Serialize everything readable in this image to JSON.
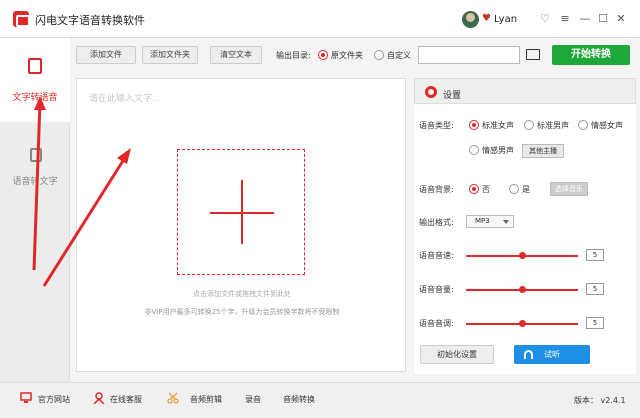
{
  "window": {
    "title": "闪电文字语音转换软件",
    "user": {
      "vip_icon": "heart-icon",
      "name": "Lyan"
    },
    "controls": [
      "skin-icon",
      "menu-icon",
      "minimize-icon",
      "maximize-icon",
      "close-icon"
    ],
    "control_glyphs": {
      "skin": "♡",
      "menu": "≡",
      "min": "—",
      "max": "☐",
      "close": "✕"
    }
  },
  "sidebar": {
    "items": [
      {
        "label": "文字转语音",
        "icon": "text-to-speech-icon",
        "active": true
      },
      {
        "label": "语音转文字",
        "icon": "speech-to-text-icon",
        "active": false
      }
    ]
  },
  "toolbar": {
    "add_file": "添加文件",
    "add_folder": "添加文件夹",
    "clear_text": "清空文本",
    "output_dir_label": "输出目录:",
    "output_options": [
      {
        "label": "原文件夹",
        "selected": true
      },
      {
        "label": "自定义",
        "selected": false
      }
    ],
    "output_path": "",
    "start_label": "开始转换"
  },
  "editor": {
    "placeholder": "请在此输入文字...",
    "drop_hint": "点击添加文件或拖拽文件到此处",
    "limit_note": "非VIP用户最多可转换25个字，升级为会员转换字数将不受限制"
  },
  "settings": {
    "title": "设置",
    "voice_type": {
      "label": "语音类型:",
      "options": [
        {
          "label": "标准女声",
          "selected": true
        },
        {
          "label": "标准男声",
          "selected": false
        },
        {
          "label": "情感女声",
          "selected": false
        },
        {
          "label": "情感男声",
          "selected": false
        }
      ],
      "other_button": "其他主播"
    },
    "background": {
      "label": "语音背景:",
      "options": [
        {
          "label": "否",
          "selected": true
        },
        {
          "label": "是",
          "selected": false
        }
      ],
      "choose_music": "选择音乐"
    },
    "format": {
      "label": "输出格式:",
      "value": "MP3"
    },
    "sliders": [
      {
        "label": "语音音速:",
        "value": 5,
        "max": 10
      },
      {
        "label": "语音音量:",
        "value": 5,
        "max": 10
      },
      {
        "label": "语音音调:",
        "value": 5,
        "max": 10
      }
    ],
    "reset_label": "初始化设置",
    "listen_label": "试听"
  },
  "footer": {
    "items": [
      {
        "label": "官方网站",
        "icon": "monitor-icon"
      },
      {
        "label": "在线客服",
        "icon": "support-icon"
      },
      {
        "label": "音频剪辑",
        "icon": "scissors-icon"
      },
      {
        "label": "录音"
      },
      {
        "label": "音频转换"
      }
    ],
    "version": "版本： v2.4.1"
  },
  "colors": {
    "accent": "#e0282b",
    "start": "#1ea83a",
    "listen": "#1f8fe6"
  }
}
